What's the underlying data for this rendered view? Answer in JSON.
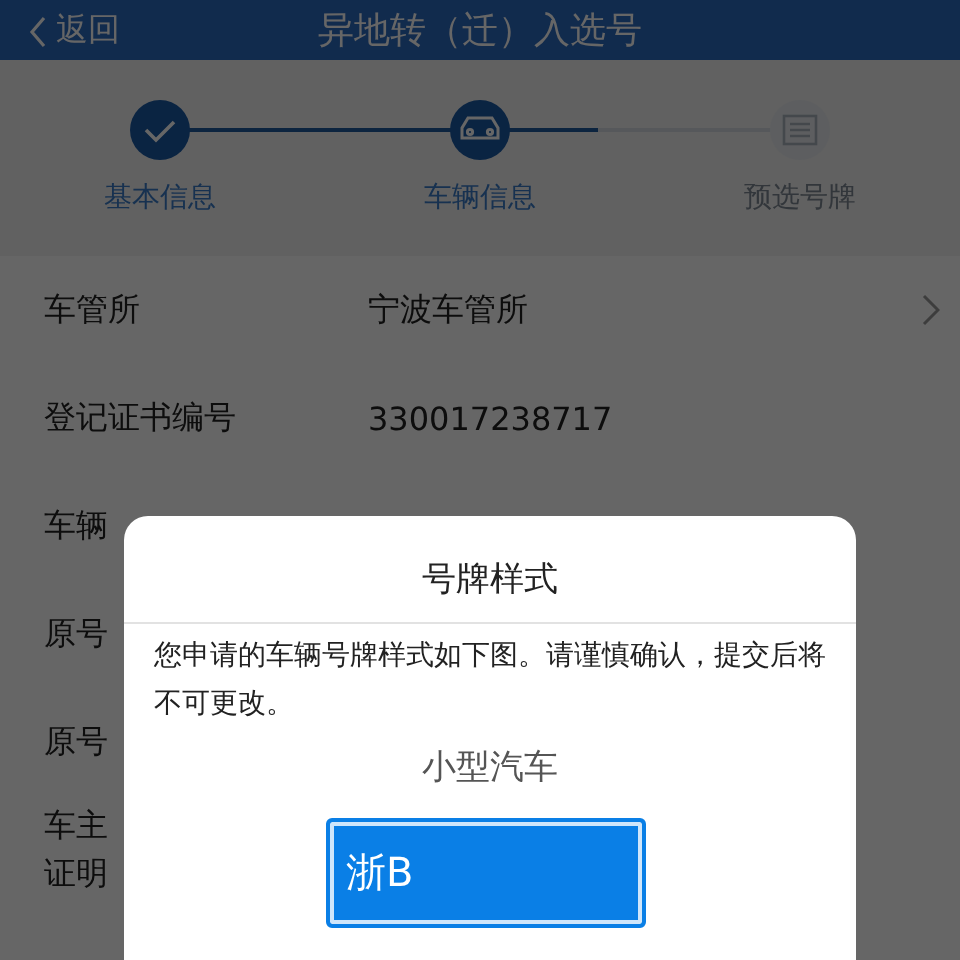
{
  "header": {
    "back": "返回",
    "title": "异地转（迁）入选号"
  },
  "steps": [
    {
      "label": "基本信息",
      "kind": "check",
      "reached": true
    },
    {
      "label": "车辆信息",
      "kind": "car",
      "reached": true
    },
    {
      "label": "预选号牌",
      "kind": "list",
      "reached": false
    }
  ],
  "progress": {
    "level": 0.67
  },
  "rows": [
    {
      "label": "车管所",
      "value": "宁波车管所",
      "link": true
    },
    {
      "label": "登记证书编号",
      "value": "330017238717",
      "link": false
    },
    {
      "label": "车辆",
      "link": false
    },
    {
      "label": "原号",
      "link": false
    },
    {
      "label": "原号",
      "link": false
    },
    {
      "lines": [
        "车主",
        "证明"
      ],
      "link": false
    }
  ],
  "dialog": {
    "title": "号牌样式",
    "message": "您申请的车辆号牌样式如下图。请谨慎确认，提交后将不可更改。",
    "vehicle_type": "小型汽车",
    "plate": "浙B"
  }
}
